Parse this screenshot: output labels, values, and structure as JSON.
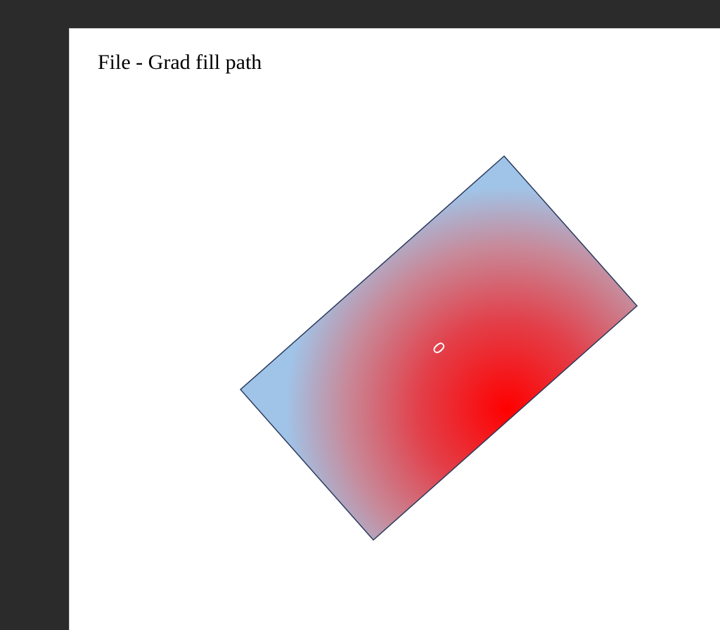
{
  "document": {
    "title": "File - Grad fill path"
  },
  "shape": {
    "label": "0",
    "gradient_stops": [
      {
        "offset": 0.0,
        "color": "#a0c4e8"
      },
      {
        "offset": 0.22,
        "color": "#a0c4e8"
      },
      {
        "offset": 0.45,
        "color": "#c78a9a"
      },
      {
        "offset": 0.7,
        "color": "#e2404a"
      },
      {
        "offset": 1.0,
        "color": "#ff0000"
      }
    ],
    "stroke_color": "#2a3a5c"
  }
}
